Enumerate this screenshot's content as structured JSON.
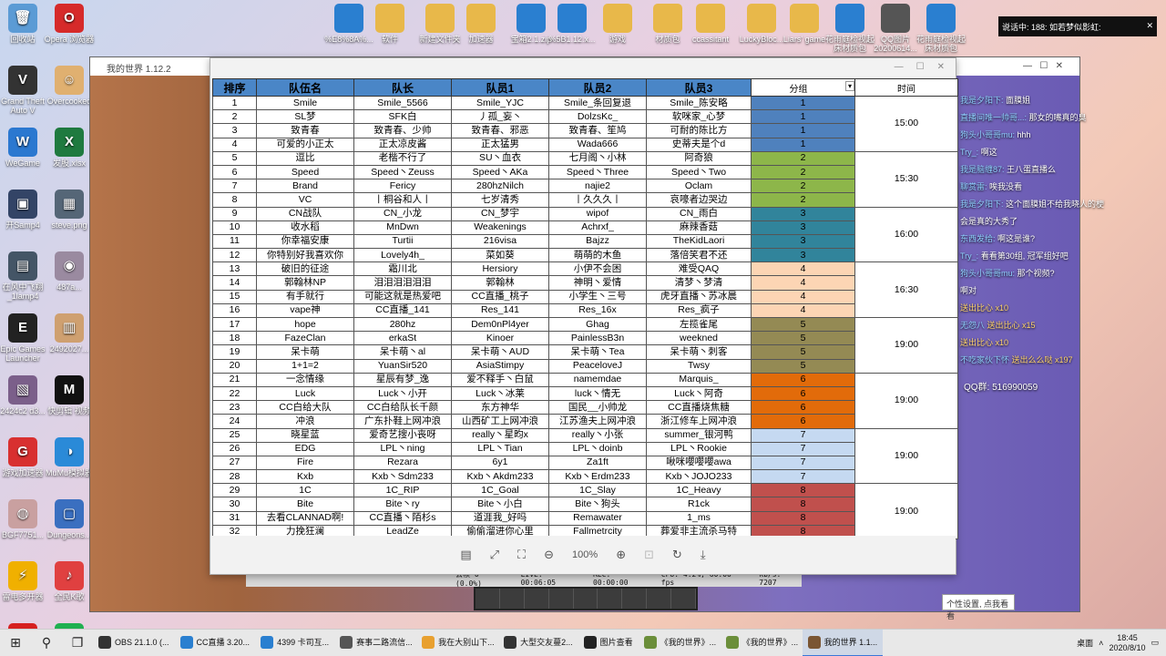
{
  "desktop_icons_left": [
    {
      "label": "回收站",
      "color": "#5b9bd5",
      "glyph": "🗑"
    },
    {
      "label": "Opera 浏览器",
      "color": "#d62a2a",
      "glyph": "O"
    },
    {
      "label": "Grand Theft Auto V",
      "color": "#333333",
      "glyph": "V"
    },
    {
      "label": "Overcooked",
      "color": "#e0b070",
      "glyph": "☺"
    },
    {
      "label": "WeGame",
      "color": "#2b78d0",
      "glyph": "W"
    },
    {
      "label": "发股.xlsx",
      "color": "#1f7a3f",
      "glyph": "X"
    },
    {
      "label": "开Samp4",
      "color": "#334466",
      "glyph": "▣"
    },
    {
      "label": "steve.png",
      "color": "#556677",
      "glyph": "▦"
    },
    {
      "label": "在风中飞翔_1lamp4",
      "color": "#445566",
      "glyph": "▤"
    },
    {
      "label": "487a...",
      "color": "#9a8aa0",
      "glyph": "◉"
    },
    {
      "label": "Epic Games Launcher",
      "color": "#222222",
      "glyph": "E"
    },
    {
      "label": "2492027...",
      "color": "#cfa070",
      "glyph": "▥"
    },
    {
      "label": "2424c2 d3...",
      "color": "#7b5f8a",
      "glyph": "▧"
    },
    {
      "label": "快剪辑 视频",
      "color": "#111111",
      "glyph": "M"
    },
    {
      "label": "游戏加速器",
      "color": "#d83030",
      "glyph": "G"
    },
    {
      "label": "MuMu模拟器",
      "color": "#2a8ad8",
      "glyph": "◑"
    },
    {
      "label": "BGF7751...",
      "color": "#c9a0a0",
      "glyph": "◍"
    },
    {
      "label": "Dungeons...",
      "color": "#3a6fc0",
      "glyph": "▢"
    },
    {
      "label": "雷电多开器",
      "color": "#f0b000",
      "glyph": "⚡"
    },
    {
      "label": "全民K歌",
      "color": "#e04040",
      "glyph": "♪"
    },
    {
      "label": "网易云音乐",
      "color": "#d62020",
      "glyph": "♫"
    },
    {
      "label": "QQ音乐",
      "color": "#20b050",
      "glyph": "♬"
    }
  ],
  "desktop_icons_top": [
    {
      "label": "%E8%8A%...",
      "color": "#2a7fd0"
    },
    {
      "label": "软件",
      "color": "#e8b84a"
    },
    {
      "label": "新建文件夹",
      "color": "#e8b84a"
    },
    {
      "label": "加速器",
      "color": "#e8b84a"
    },
    {
      "label": "宝箱2.1.zip",
      "color": "#2a7fd0"
    },
    {
      "label": "%5B1.12.x...",
      "color": "#2a7fd0"
    },
    {
      "label": "游戏",
      "color": "#e8b84a"
    },
    {
      "label": "材质包",
      "color": "#e8b84a"
    },
    {
      "label": "ccassitant",
      "color": "#e8b84a"
    },
    {
      "label": "LuckyBloc...",
      "color": "#e8b84a"
    },
    {
      "label": "Liars' game",
      "color": "#e8b84a"
    },
    {
      "label": "花雨庭检视起床材质包",
      "color": "#2a7fd0"
    },
    {
      "label": "QQ图片20200614...",
      "color": "#555555"
    },
    {
      "label": "花雨庭检视起床材质包",
      "color": "#2a7fd0"
    }
  ],
  "game_window": {
    "title": "我的世界 1.12.2",
    "stats": [
      "丢帧 0 (0.0%)",
      "LIVE: 00:06:05",
      "REC: 00:00:00",
      "CPU: 4.2%, 60.00 fps",
      "kb/s: 7207"
    ]
  },
  "viewer": {
    "toolbar_zoom": "100%"
  },
  "table": {
    "headers": [
      "排序",
      "队伍名",
      "队长",
      "队员1",
      "队员2",
      "队员3",
      "分组",
      "时间"
    ],
    "rows": [
      {
        "n": "1",
        "team": "Smile",
        "cap": "Smile_5566",
        "m1": "Smile_YJC",
        "m2": "Smile_条回复退",
        "m3": "Smile_陈安略",
        "g": "1"
      },
      {
        "n": "2",
        "team": "SL梦",
        "cap": "SFK白",
        "m1": "丿孤_妄丶",
        "m2": "DolzsKc_",
        "m3": "软咪家_心梦",
        "g": "1"
      },
      {
        "n": "3",
        "team": "致青春",
        "cap": "致青春、少帅",
        "m1": "致青春、邪恶",
        "m2": "致青春、笙鸠",
        "m3": "可耐的陈比方",
        "g": "1"
      },
      {
        "n": "4",
        "team": "可爱的小正太",
        "cap": "正太凉皮酱",
        "m1": "正太猛男",
        "m2": "Wada666",
        "m3": "史蒂夫是个d",
        "g": "1"
      },
      {
        "n": "5",
        "team": "逗比",
        "cap": "老楷不行了",
        "m1": "SU丶血衣",
        "m2": "七月阁丶小林",
        "m3": "阿奇狼",
        "g": "2"
      },
      {
        "n": "6",
        "team": "Speed",
        "cap": "Speed丶Zeuss",
        "m1": "Speed丶AKa",
        "m2": "Speed丶Three",
        "m3": "Speed丶Two",
        "g": "2"
      },
      {
        "n": "7",
        "team": "Brand",
        "cap": "Fericy",
        "m1": "280hzNilch",
        "m2": "najie2",
        "m3": "Oclam",
        "g": "2"
      },
      {
        "n": "8",
        "team": "VC",
        "cap": "丨桐谷和人丨",
        "m1": "七岁清秀",
        "m2": "丨久久久丨",
        "m3": "哀嚎者边哭边",
        "g": "2"
      },
      {
        "n": "9",
        "team": "CN战队",
        "cap": "CN_小龙",
        "m1": "CN_梦宇",
        "m2": "wipof",
        "m3": "CN_雨白",
        "g": "3"
      },
      {
        "n": "10",
        "team": "收水稻",
        "cap": "MnDwn",
        "m1": "Weakenings",
        "m2": "Achrxf_",
        "m3": "麻辣香菇",
        "g": "3"
      },
      {
        "n": "11",
        "team": "你幸福安康",
        "cap": "Turtii",
        "m1": "216visa",
        "m2": "Bajzz",
        "m3": "TheKidLaori",
        "g": "3"
      },
      {
        "n": "12",
        "team": "你特别好我喜欢你",
        "cap": "Lovely4h_",
        "m1": "菜如葵",
        "m2": "萌萌的木鱼",
        "m3": "落倍笑君不还",
        "g": "3"
      },
      {
        "n": "13",
        "team": "破旧的征途",
        "cap": "霜川北",
        "m1": "Hersiory",
        "m2": "小伊不会困",
        "m3": "难受QAQ",
        "g": "4"
      },
      {
        "n": "14",
        "team": "郭翰林NP",
        "cap": "泪泪泪泪泪泪",
        "m1": "郭翰林",
        "m2": "神明丶爱情",
        "m3": "清梦丶梦清",
        "g": "4"
      },
      {
        "n": "15",
        "team": "有手就行",
        "cap": "可能这就是热爱吧",
        "m1": "CC直播_桃子",
        "m2": "小学生丶三号",
        "m3": "虎牙直播丶苏冰晨",
        "g": "4"
      },
      {
        "n": "16",
        "team": "vape神",
        "cap": "CC直播_141",
        "m1": "Res_141",
        "m2": "Res_16x",
        "m3": "Res_疯子",
        "g": "4"
      },
      {
        "n": "17",
        "team": "hope",
        "cap": "280hz",
        "m1": "Dem0nPl4yer",
        "m2": "Ghag",
        "m3": "左揽雀尾",
        "g": "5"
      },
      {
        "n": "18",
        "team": "FazeClan",
        "cap": "erkaSt",
        "m1": "Kinoer",
        "m2": "PainlessB3n",
        "m3": "weekned",
        "g": "5"
      },
      {
        "n": "19",
        "team": "呆卡萌",
        "cap": "呆卡萌丶al",
        "m1": "呆卡萌丶AUD",
        "m2": "呆卡萌丶Tea",
        "m3": "呆卡萌丶刺客",
        "g": "5"
      },
      {
        "n": "20",
        "team": "1+1=2",
        "cap": "YuanSir520",
        "m1": "AsiaStimpy",
        "m2": "PeaceloveJ",
        "m3": "Twsy",
        "g": "5"
      },
      {
        "n": "21",
        "team": "一念情缘",
        "cap": "星辰有梦_逸",
        "m1": "爱不释手丶白鼠",
        "m2": "namemdae",
        "m3": "Marquis_",
        "g": "6"
      },
      {
        "n": "22",
        "team": "Luck",
        "cap": "Luck丶小开",
        "m1": "Luck丶冰莱",
        "m2": "luck丶情无",
        "m3": "Luck丶阿奇",
        "g": "6"
      },
      {
        "n": "23",
        "team": "CC白给大队",
        "cap": "CC白给队长千颜",
        "m1": "东方神华",
        "m2": "国民__小帅龙",
        "m3": "CC直播烧焦糖",
        "g": "6"
      },
      {
        "n": "24",
        "team": "冲浪",
        "cap": "广东扑鞋上网冲浪",
        "m1": "山西矿工上网冲浪",
        "m2": "江苏渔夫上网冲浪",
        "m3": "浙江修车上网冲浪",
        "g": "6"
      },
      {
        "n": "25",
        "team": "晓星蓝",
        "cap": "爱奇艺搜小丧呀",
        "m1": "really丶星昀x",
        "m2": "really丶小张",
        "m3": "summer_银河鸭",
        "g": "7"
      },
      {
        "n": "26",
        "team": "EDG",
        "cap": "LPL丶ning",
        "m1": "LPL丶Tian",
        "m2": "LPL丶doinb",
        "m3": "LPL丶Rookie",
        "g": "7"
      },
      {
        "n": "27",
        "team": "Fire",
        "cap": "Rezara",
        "m1": "6y1",
        "m2": "Za1ft",
        "m3": "啾咪嚶嚶嚶awa",
        "g": "7"
      },
      {
        "n": "28",
        "team": "Kxb",
        "cap": "Kxb丶Sdm233",
        "m1": "Kxb丶Akdm233",
        "m2": "Kxb丶Erdm233",
        "m3": "Kxb丶JOJO233",
        "g": "7"
      },
      {
        "n": "29",
        "team": "1C",
        "cap": "1C_RIP",
        "m1": "1C_Goal",
        "m2": "1C_Slay",
        "m3": "1C_Heavy",
        "g": "8"
      },
      {
        "n": "30",
        "team": "Bite",
        "cap": "Bite丶ry",
        "m1": "Bite丶小白",
        "m2": "Bite丶狗头",
        "m3": "R1ck",
        "g": "8"
      },
      {
        "n": "31",
        "team": "去看CLANNAD啊!",
        "cap": "CC直播丶陌杉s",
        "m1": "道涯我_好吗",
        "m2": "Remawater",
        "m3": "1_ms",
        "g": "8"
      },
      {
        "n": "32",
        "team": "力挽狂澜",
        "cap": "LeadZe",
        "m1": "偷偷溜进你心里",
        "m2": "Fallmetrcity",
        "m3": "葬爱非主流杀马特",
        "g": "8"
      }
    ],
    "times": [
      "15:00",
      "15:30",
      "16:00",
      "16:30",
      "19:00",
      "19:00",
      "19:00",
      "19:00"
    ]
  },
  "chat": {
    "header": "说话中: 188: 如若梦似影虹:",
    "lines": [
      {
        "name": "我是夕阳下:",
        "text": "面膜姐"
      },
      {
        "name": "直播间唯一帅哥...:",
        "text": "那女的嘴真的臭"
      },
      {
        "name": "狗头小哥哥mu:",
        "text": "hhh"
      },
      {
        "name": "Try_:",
        "text": "啊这"
      },
      {
        "name": "我是脑缠87:",
        "text": "王八蛋直播么"
      },
      {
        "name": "聊赏雷:",
        "text": "唉我没看"
      },
      {
        "name": "我是夕阳下:",
        "text": "这个面膜姐不给我晓人的梗"
      },
      {
        "name": "",
        "text": "会是真的大秀了"
      },
      {
        "name": "东西发给:",
        "text": "啊这是谁?"
      },
      {
        "name": "Try_:",
        "text": "看看第30组, 冠军组好吧"
      },
      {
        "name": "狗头小哥哥mu:",
        "text": "那个视频?"
      },
      {
        "name": "",
        "text": "啊对"
      },
      {
        "name": "",
        "text": "送出比心 x10",
        "gift": true
      },
      {
        "name": "无怨八",
        "text": "送出比心 x15",
        "gift": true
      },
      {
        "name": "",
        "text": "送出比心 x10",
        "gift": true
      },
      {
        "name": "不吃家伙下怀",
        "text": "送出么么哒 x197",
        "gift": true
      }
    ],
    "qq_group": "QQ群: 516990059",
    "toast": "个性设置, 点我看看"
  },
  "taskbar": {
    "items": [
      {
        "label": "OBS 21.1.0 (...",
        "color": "#333333",
        "active": false
      },
      {
        "label": "CC直播 3.20...",
        "color": "#2a7fd0",
        "active": false
      },
      {
        "label": "4399 卡司互...",
        "color": "#2a7fd0",
        "active": false
      },
      {
        "label": "赛事二路流信...",
        "color": "#555555",
        "active": false
      },
      {
        "label": "我在大别山下...",
        "color": "#e8a030",
        "active": false
      },
      {
        "label": "大型交友蔓2...",
        "color": "#333333",
        "active": false
      },
      {
        "label": "图片查看",
        "color": "#222222",
        "active": false
      },
      {
        "label": "《我的世界》...",
        "color": "#6b8e3a",
        "active": false
      },
      {
        "label": "《我的世界》...",
        "color": "#6b8e3a",
        "active": false
      },
      {
        "label": "我的世界 1.1...",
        "color": "#7a5533",
        "active": true
      }
    ],
    "tray_label": "桌面",
    "time": "18:45",
    "date": "2020/8/10"
  }
}
